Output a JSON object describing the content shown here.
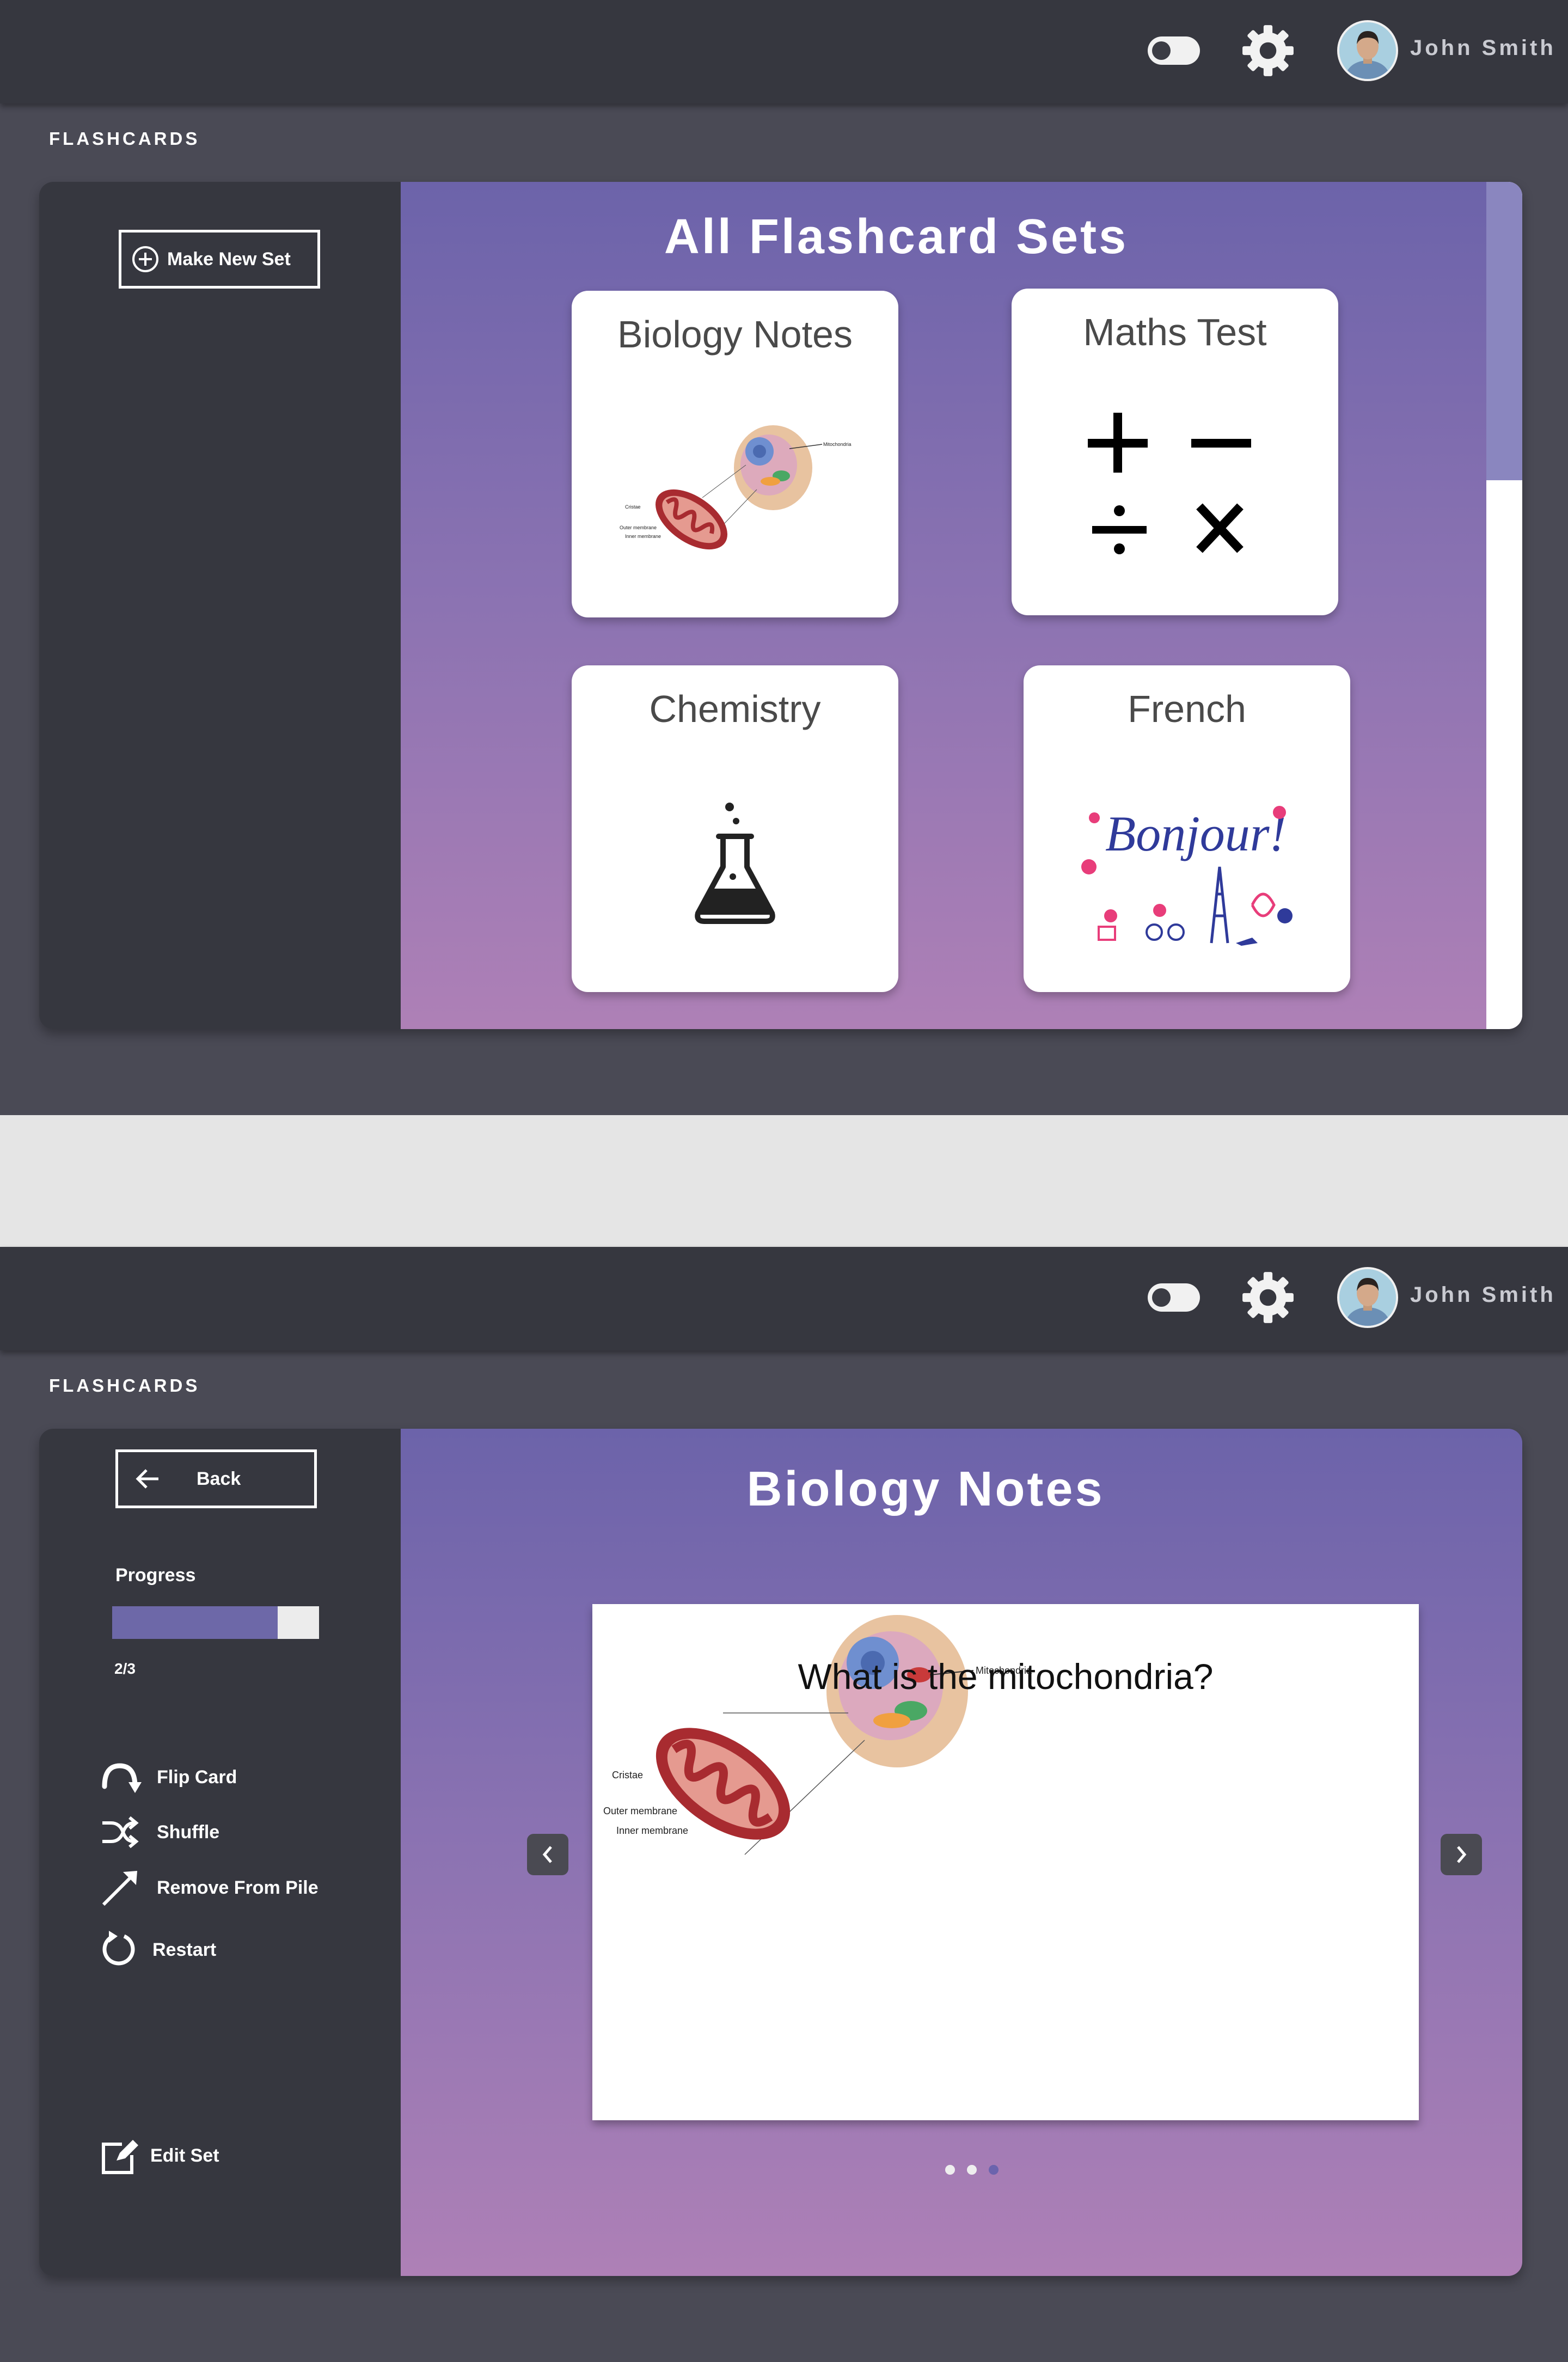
{
  "header": {
    "username": "John Smith",
    "toggle_icon": "toggle-icon",
    "settings_icon": "gear-icon"
  },
  "screen1": {
    "section_label": "FLASHCARDS",
    "sidebar": {
      "make_new_set_label": "Make New Set"
    },
    "title": "All Flashcard Sets",
    "cards": [
      {
        "label": "Biology Notes",
        "icon": "cell-diagram"
      },
      {
        "label": "Maths Test",
        "icon": "math-operators"
      },
      {
        "label": "Chemistry",
        "icon": "flask-icon"
      },
      {
        "label": "French",
        "icon": "bonjour-illustration"
      }
    ],
    "diagram_labels": {
      "mitochondria": "Mitochondria",
      "cristae": "Cristae",
      "outer": "Outer membrane",
      "inner": "Inner membrane"
    },
    "bonjour_text": "Bonjour!"
  },
  "screen2": {
    "section_label": "FLASHCARDS",
    "back_label": "Back",
    "progress_label": "Progress",
    "progress_value": 0.8,
    "progress_text": "2/3",
    "actions": {
      "flip": "Flip Card",
      "shuffle": "Shuffle",
      "remove": "Remove From Pile",
      "restart": "Restart",
      "edit": "Edit Set"
    },
    "title": "Biology Notes",
    "question": "What is the mitochondria?",
    "diagram_labels": {
      "mitochondria": "Mitochondria",
      "cristae": "Cristae",
      "outer": "Outer membrane",
      "inner": "Inner membrane"
    },
    "dots": {
      "count": 3,
      "active": 3
    }
  },
  "colors": {
    "accent": "#6d68a8",
    "background": "#4a4a55",
    "topbar": "#36373f"
  }
}
